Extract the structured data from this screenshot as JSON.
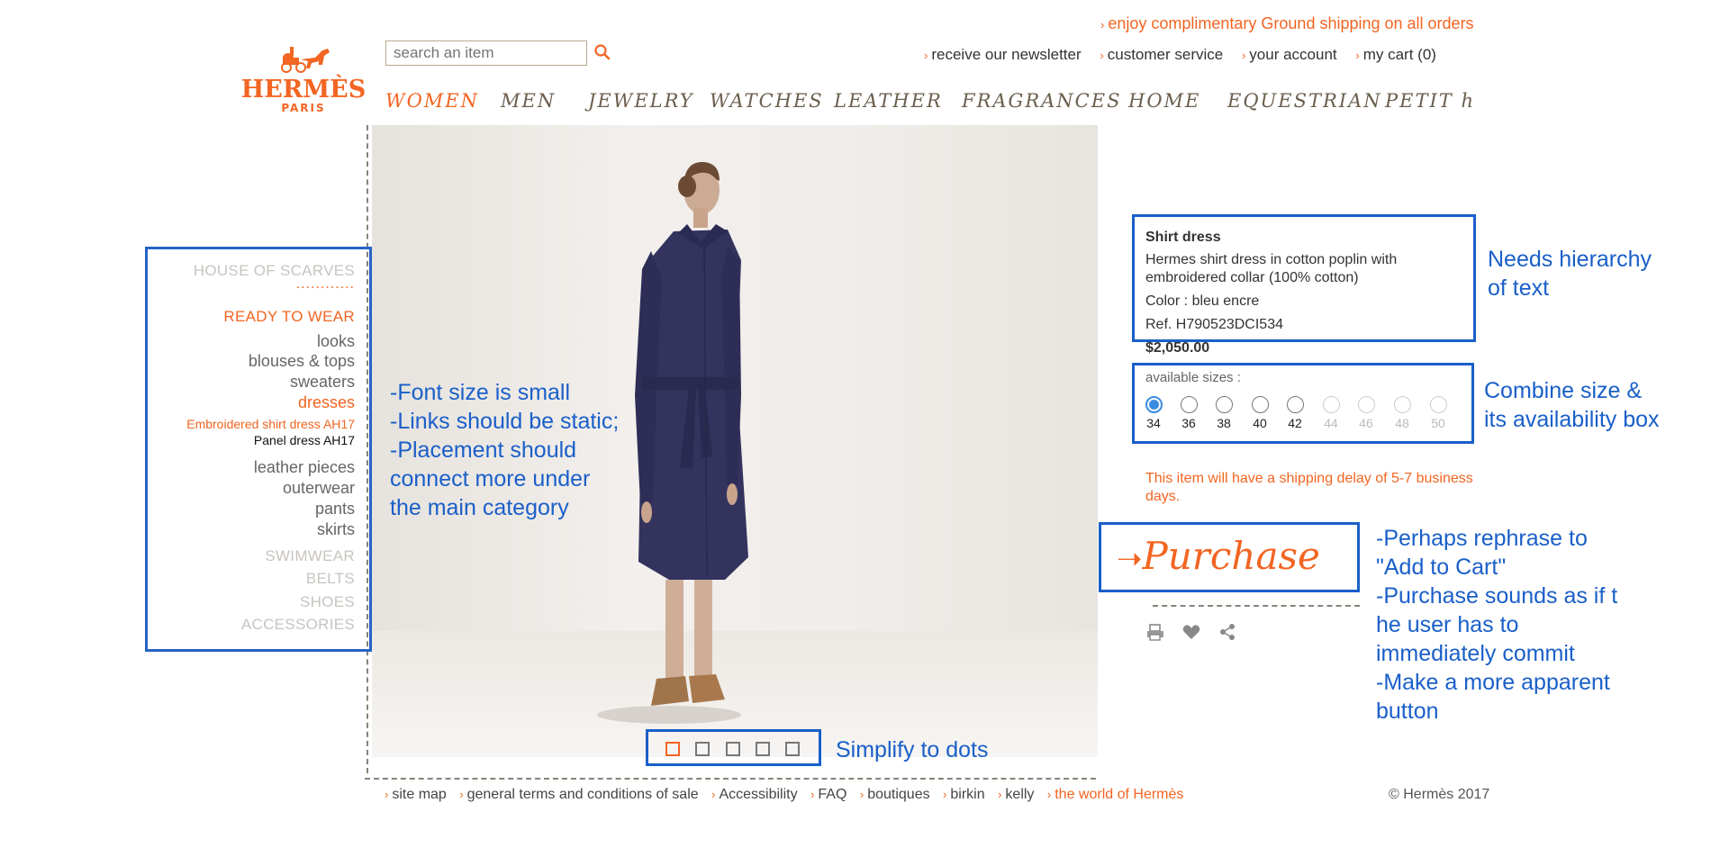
{
  "header": {
    "promo": "enjoy complimentary Ground shipping on all orders",
    "logo_text": "HERMÈS",
    "logo_subtext": "PARIS",
    "search_placeholder": "search an item",
    "utility_links": [
      "receive our newsletter",
      "customer service",
      "your account",
      "my cart (0)"
    ]
  },
  "nav": {
    "items": [
      "WOMEN",
      "MEN",
      "JEWELRY",
      "WATCHES",
      "LEATHER",
      "FRAGRANCES",
      "HOME",
      "EQUESTRIAN",
      "PETIT h"
    ],
    "active": "WOMEN"
  },
  "sidebar": {
    "house_of_scarves": "HOUSE OF SCARVES",
    "dotted_divider": "............",
    "ready_to_wear": "READY TO WEAR",
    "sub": {
      "looks": "looks",
      "blouses": "blouses & tops",
      "sweaters": "sweaters",
      "dresses": "dresses",
      "embroidered": "Embroidered shirt dress AH17",
      "panel": "Panel dress AH17",
      "leather": "leather pieces",
      "outerwear": "outerwear",
      "pants": "pants",
      "skirts": "skirts"
    },
    "swimwear": "SWIMWEAR",
    "belts": "BELTS",
    "shoes": "SHOES",
    "accessories": "ACCESSORIES"
  },
  "annotations": {
    "sidebar_note": [
      "-Font size is small",
      "-Links should be static;",
      "-Placement should",
      "connect more under",
      "the main category"
    ],
    "text_note": [
      "Needs hierarchy",
      "of text"
    ],
    "size_note": [
      "Combine size &",
      "its availability box"
    ],
    "purchase_note": [
      "-Perhaps rephrase to",
      "\"Add to Cart\"",
      "-Purchase sounds as if t",
      "he user has to",
      "immediately commit",
      "-Make a more apparent",
      "button"
    ],
    "dots_note": "Simplify to dots"
  },
  "product": {
    "name": "Shirt dress",
    "description": "Hermes shirt dress in cotton poplin with embroidered collar (100% cotton)",
    "color": "Color : bleu encre",
    "ref": "Ref. H790523DCI534",
    "price": "$2,050.00",
    "sizes_label": "available sizes :",
    "sizes": [
      {
        "size": "34",
        "state": "selected"
      },
      {
        "size": "36",
        "state": "available"
      },
      {
        "size": "38",
        "state": "available"
      },
      {
        "size": "40",
        "state": "available"
      },
      {
        "size": "42",
        "state": "available"
      },
      {
        "size": "44",
        "state": "unavailable"
      },
      {
        "size": "46",
        "state": "unavailable"
      },
      {
        "size": "48",
        "state": "unavailable"
      },
      {
        "size": "50",
        "state": "unavailable"
      }
    ],
    "shipping_delay": "This item will have a shipping delay of 5-7 business days.",
    "purchase_label": "Purchase"
  },
  "footer": {
    "links": [
      "site map",
      "general terms and conditions of sale",
      "Accessibility",
      "FAQ",
      "boutiques",
      "birkin",
      "kelly"
    ],
    "world_link": "the world of Hermès",
    "copyright": "© Hermès 2017"
  },
  "colors": {
    "brand_orange": "#f26522",
    "annotation_blue": "#1a5fc9",
    "dress_navy": "#33335e"
  }
}
